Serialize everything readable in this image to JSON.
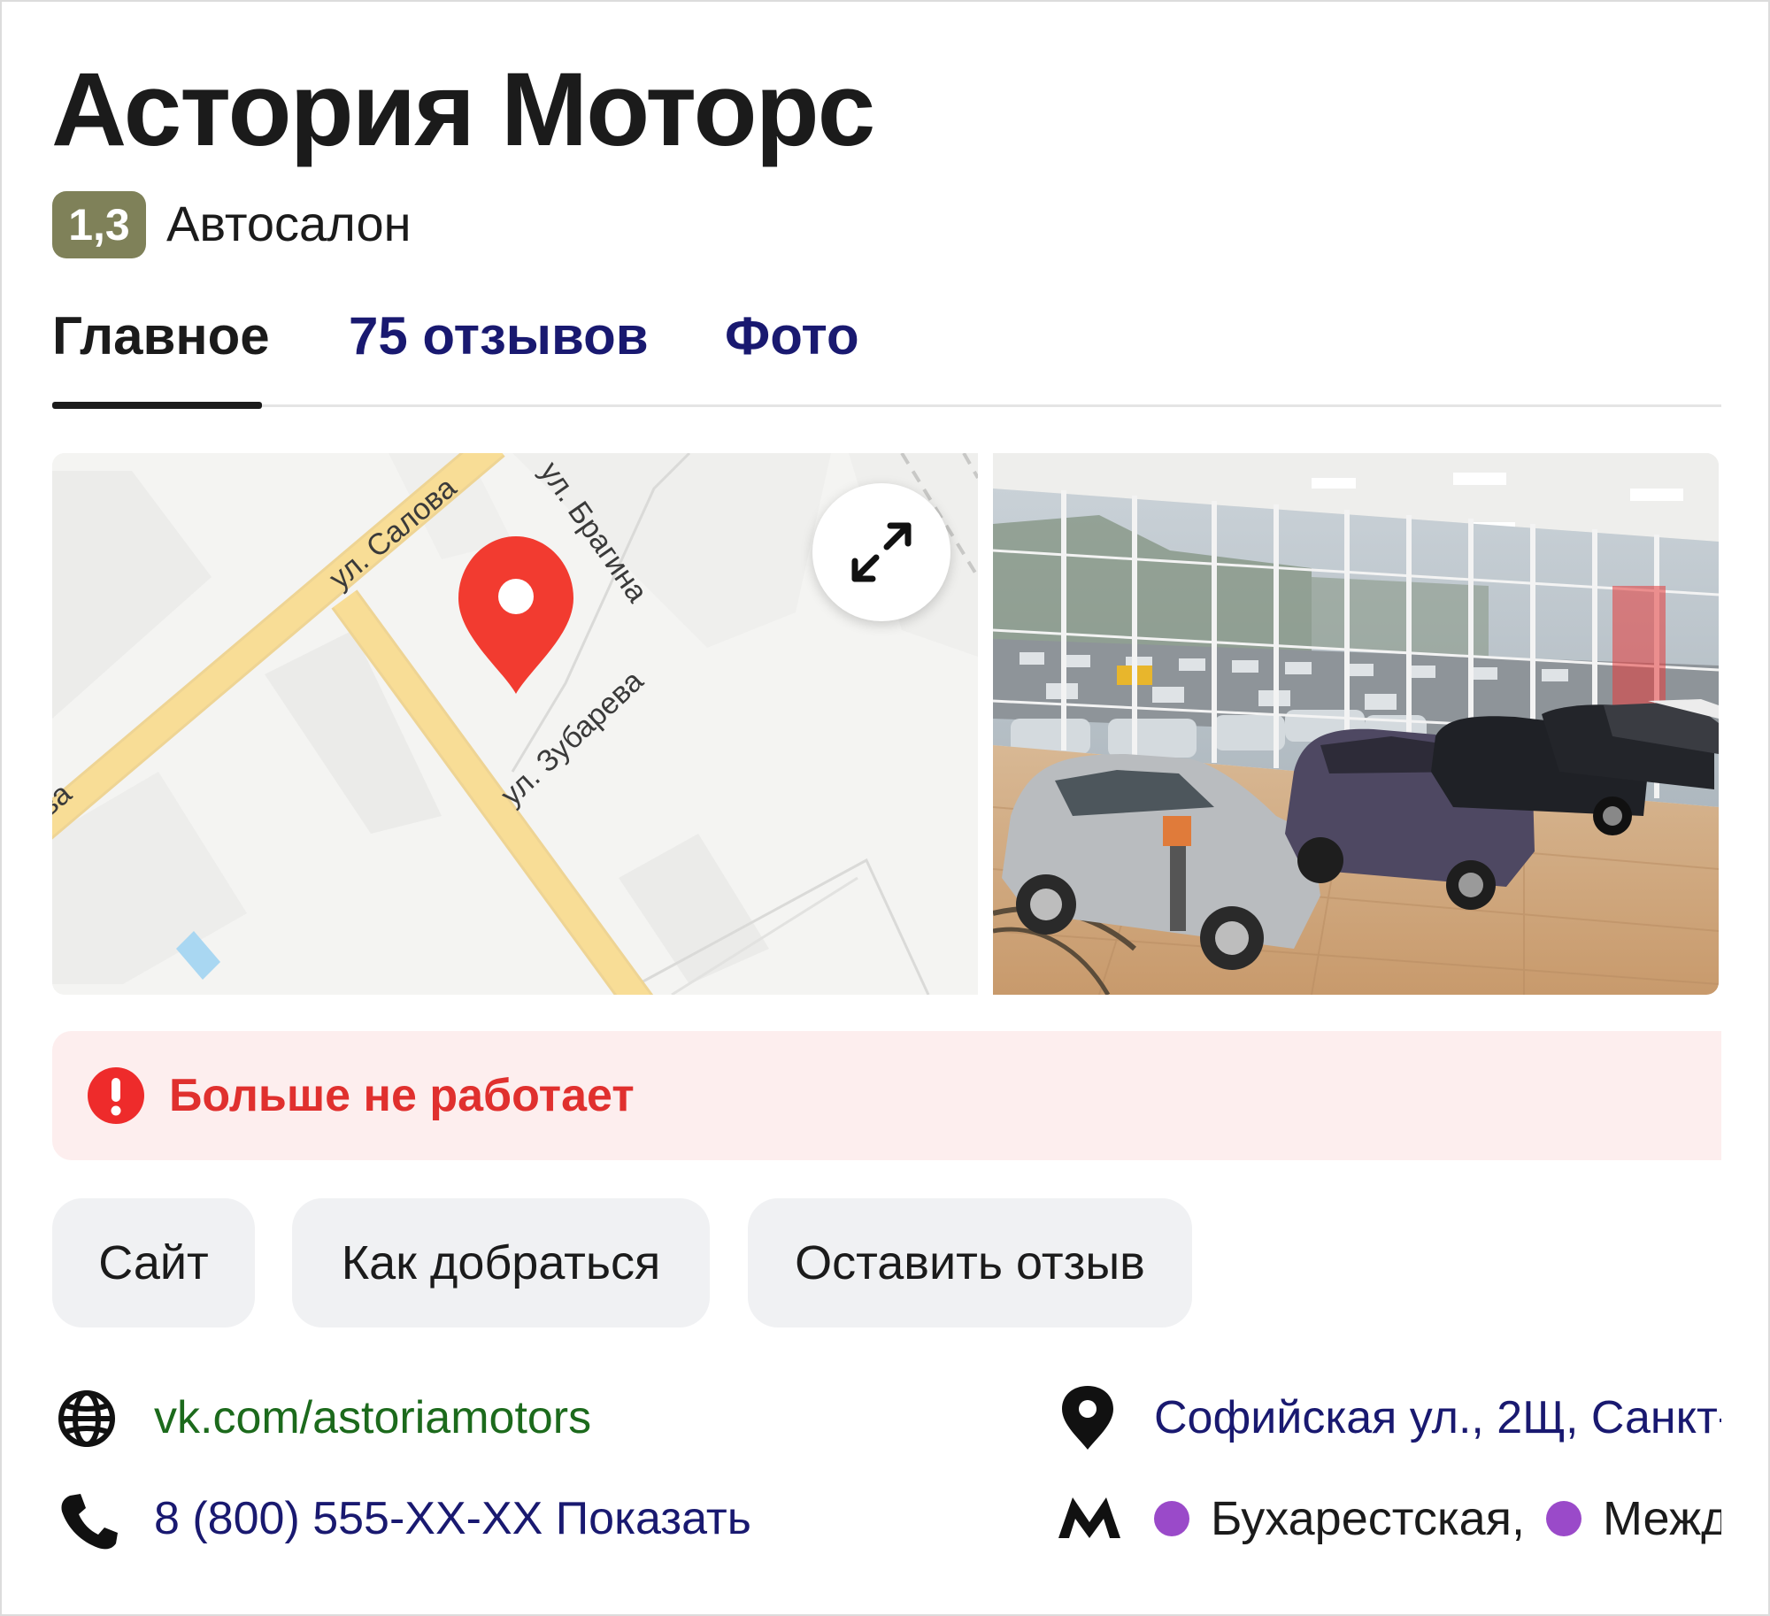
{
  "place": {
    "name": "Астория Моторс",
    "rating": "1,3",
    "category": "Автосалон"
  },
  "tabs": [
    {
      "label": "Главное",
      "active": true
    },
    {
      "label": "75 отзывов",
      "active": false
    },
    {
      "label": "Фото",
      "active": false
    }
  ],
  "map": {
    "streets": [
      "ул. Салова",
      "ул. Брагина",
      "ул. Зубарева",
      "ва"
    ],
    "expand_icon": "expand-arrows-icon",
    "marker_icon": "map-pin-icon",
    "marker_color": "#f23b30"
  },
  "alert": {
    "text": "Больше не работает",
    "icon": "exclamation-circle-icon",
    "color": "#e0302e"
  },
  "actions": [
    {
      "label": "Сайт"
    },
    {
      "label": "Как добраться"
    },
    {
      "label": "Оставить отзыв"
    }
  ],
  "contacts": {
    "website": {
      "icon": "globe-icon",
      "text": "vk.com/astoriamotors"
    },
    "phone": {
      "icon": "phone-icon",
      "text": "8 (800) 555-XX-XX Показать"
    },
    "address": {
      "icon": "location-pin-icon",
      "text": "Софийская ул., 2Щ, Санкт-"
    },
    "metro": {
      "icon": "metro-icon",
      "stations": [
        {
          "name": "Бухарестская,",
          "color": "#9a4ac9"
        },
        {
          "name": "Межд",
          "color": "#9a4ac9"
        }
      ]
    }
  },
  "colors": {
    "rating_badge": "#7f8159",
    "link": "#191970",
    "website": "#1c6a1c",
    "alert_bg": "#fdeeee"
  }
}
